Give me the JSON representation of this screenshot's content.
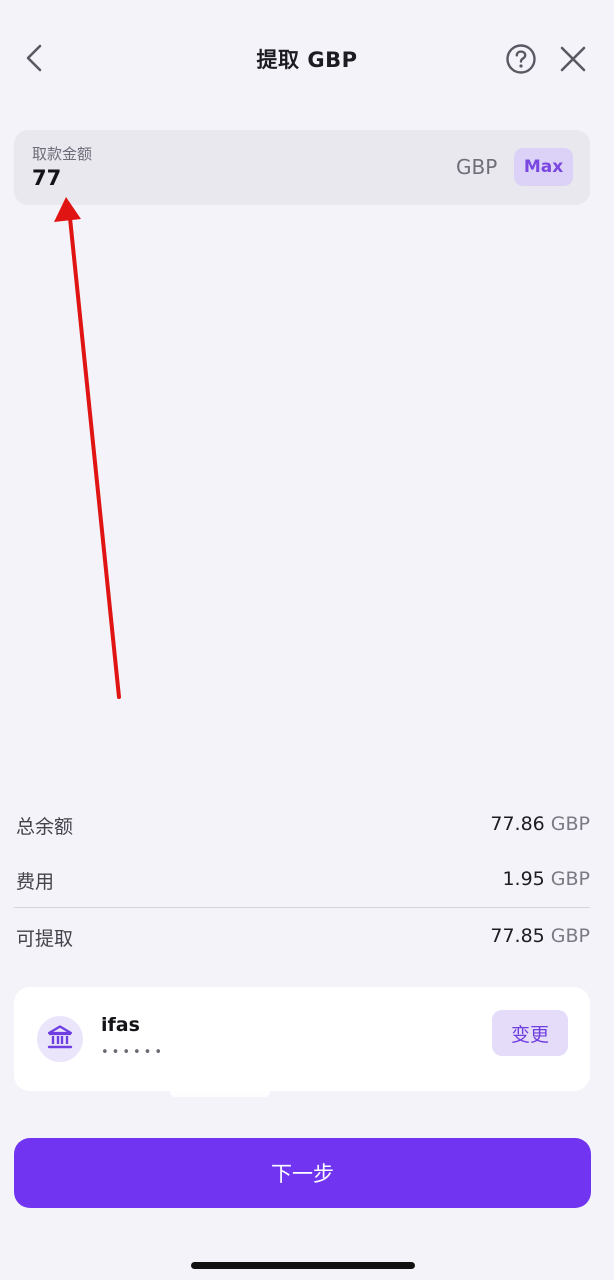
{
  "header": {
    "title": "提取 GBP",
    "back_icon": "chevron-left-icon",
    "help_icon": "question-circle-icon",
    "close_icon": "close-icon"
  },
  "amount": {
    "label": "取款金额",
    "value": "77",
    "currency": "GBP",
    "max_label": "Max"
  },
  "summary": {
    "total_balance": {
      "label": "总余额",
      "value": "77.86",
      "currency": "GBP"
    },
    "fee": {
      "label": "费用",
      "value": "1.95",
      "currency": "GBP"
    },
    "withdrawable": {
      "label": "可提取",
      "value": "77.85",
      "currency": "GBP"
    }
  },
  "bank": {
    "icon": "bank-icon",
    "name": "ifas",
    "account_mask": "••••••",
    "change_label": "变更"
  },
  "next_label": "下一步",
  "colors": {
    "background": "#f4f3f9",
    "accent": "#7135f1",
    "accent_soft": "#dcd2f8",
    "annotation_arrow": "#e11414"
  }
}
